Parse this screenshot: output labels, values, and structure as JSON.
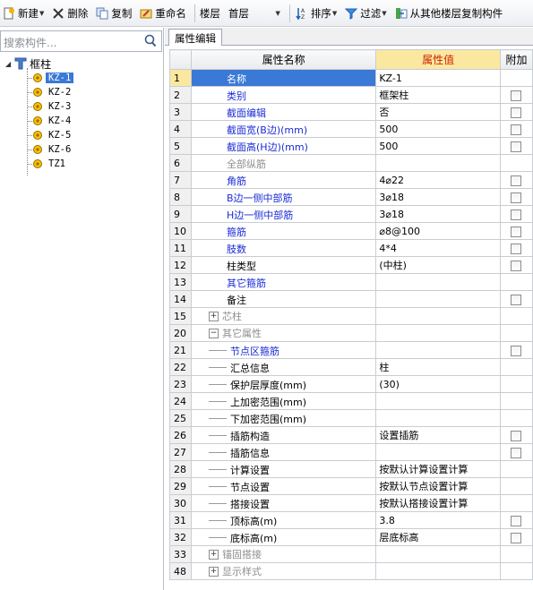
{
  "toolbar": {
    "new_label": "新建",
    "delete_label": "删除",
    "copy_label": "复制",
    "rename_label": "重命名",
    "floor_label": "楼层",
    "floor_value": "首层",
    "sort_label": "排序",
    "filter_label": "过滤",
    "copy_from_floor_label": "从其他楼层复制构件"
  },
  "search": {
    "placeholder": "搜索构件..."
  },
  "tree": {
    "root": "框柱",
    "items": [
      "KZ-1",
      "KZ-2",
      "KZ-3",
      "KZ-4",
      "KZ-5",
      "KZ-6",
      "TZ1"
    ]
  },
  "tab": {
    "label": "属性编辑"
  },
  "grid": {
    "headers": {
      "name": "属性名称",
      "value": "属性值",
      "extra": "附加"
    },
    "rows": [
      {
        "num": "1",
        "name": "名称",
        "value": "KZ-1"
      },
      {
        "num": "2",
        "name": "类别",
        "value": "框架柱"
      },
      {
        "num": "3",
        "name": "截面编辑",
        "value": "否"
      },
      {
        "num": "4",
        "name": "截面宽(B边)(mm)",
        "value": "500"
      },
      {
        "num": "5",
        "name": "截面高(H边)(mm)",
        "value": "500"
      },
      {
        "num": "6",
        "name": "全部纵筋",
        "value": ""
      },
      {
        "num": "7",
        "name": "角筋",
        "value": "4⌀22"
      },
      {
        "num": "8",
        "name": "B边一侧中部筋",
        "value": "3⌀18"
      },
      {
        "num": "9",
        "name": "H边一侧中部筋",
        "value": "3⌀18"
      },
      {
        "num": "10",
        "name": "箍筋",
        "value": "⌀8@100"
      },
      {
        "num": "11",
        "name": "肢数",
        "value": "4*4"
      },
      {
        "num": "12",
        "name": "柱类型",
        "value": "(中柱)"
      },
      {
        "num": "13",
        "name": "其它箍筋",
        "value": ""
      },
      {
        "num": "14",
        "name": "备注",
        "value": ""
      },
      {
        "num": "15",
        "name": "芯柱",
        "value": ""
      },
      {
        "num": "20",
        "name": "其它属性",
        "value": ""
      },
      {
        "num": "21",
        "name": "节点区箍筋",
        "value": ""
      },
      {
        "num": "22",
        "name": "汇总信息",
        "value": "柱"
      },
      {
        "num": "23",
        "name": "保护层厚度(mm)",
        "value": "(30)"
      },
      {
        "num": "24",
        "name": "上加密范围(mm)",
        "value": ""
      },
      {
        "num": "25",
        "name": "下加密范围(mm)",
        "value": ""
      },
      {
        "num": "26",
        "name": "插筋构造",
        "value": "设置插筋"
      },
      {
        "num": "27",
        "name": "插筋信息",
        "value": ""
      },
      {
        "num": "28",
        "name": "计算设置",
        "value": "按默认计算设置计算"
      },
      {
        "num": "29",
        "name": "节点设置",
        "value": "按默认节点设置计算"
      },
      {
        "num": "30",
        "name": "搭接设置",
        "value": "按默认搭接设置计算"
      },
      {
        "num": "31",
        "name": "顶标高(m)",
        "value": "3.8"
      },
      {
        "num": "32",
        "name": "底标高(m)",
        "value": "层底标高"
      },
      {
        "num": "33",
        "name": "锚固搭接",
        "value": ""
      },
      {
        "num": "48",
        "name": "显示样式",
        "value": ""
      }
    ]
  }
}
